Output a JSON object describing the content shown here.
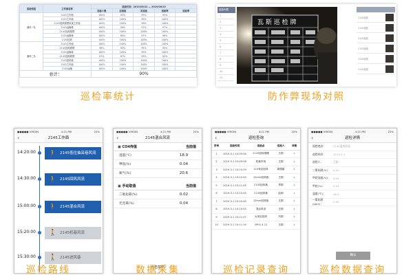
{
  "captions": {
    "stats": "巡检率统计",
    "photo": "防作弊现场对照",
    "route": "巡检路线",
    "collect": "数据采集",
    "records": "巡检记录查询",
    "detail": "巡检数据查询"
  },
  "stats_table": {
    "headers": [
      "巡检班组",
      "工作面名称",
      "巡检时间：2019/08/22 — 2019/08/23"
    ],
    "subheaders": [
      "",
      "",
      "巡检人数",
      "应巡检",
      "实巡检",
      "巡检率",
      "巡检率"
    ],
    "groups": [
      {
        "name": "通风一队",
        "rows": [
          [
            "2145工作面",
            "100%",
            "92%",
            "95%",
            "95%"
          ],
          [
            "2145工作面",
            "100%",
            "100%",
            "99%",
            "100%"
          ],
          [
            "2145回风顺槽采煤工作面",
            "100%",
            "100%",
            "99%",
            "100%"
          ],
          [
            "2145运输巷",
            "100%",
            "90%",
            "97%",
            "97%"
          ],
          [
            "2145回风顺槽",
            "100%",
            "100%",
            "100%",
            "100%"
          ],
          [
            "2145运输巷",
            "100%",
            "80%",
            "87%",
            "96%"
          ],
          [
            "2145回风",
            "100%",
            "100%",
            "100%",
            "100%"
          ]
        ]
      },
      {
        "name": "通风二队",
        "rows": [
          [
            "2145工作面",
            "100%",
            "100%",
            "100%",
            "100%"
          ],
          [
            "2145回风顺槽",
            "98%",
            "92%",
            "95%",
            "95%"
          ],
          [
            "2145运输巷",
            "100%",
            "100%",
            "99%",
            "100%"
          ],
          [
            "2145回风顺槽",
            "87%",
            "87%",
            "93%",
            "92%"
          ],
          [
            "2145回风巷",
            "100%",
            "100%",
            "100%",
            "100%"
          ],
          [
            "2145工作面",
            "100%",
            "100%",
            "100%",
            "100%"
          ],
          [
            "2145运输",
            "100%",
            "100%",
            "100%",
            "100%"
          ]
        ]
      }
    ],
    "total_label": "总计：",
    "total_value": "90%"
  },
  "photo_panel": {
    "list_title": "巡检列表",
    "list_rows": [
      "1",
      "2",
      "3",
      "4",
      "5",
      "6",
      "7",
      "8",
      "9",
      "10",
      "11"
    ],
    "thumb_labels": [
      "2145巡检",
      "2145巡检",
      "2145巡检",
      "2145巡检",
      "2145巡检",
      "2145巡检"
    ]
  },
  "route_phone": {
    "status_left": "●●●●● VIRGIN",
    "status_time": "4:21 PM",
    "status_right": "22%",
    "title": "2145工作面",
    "items": [
      {
        "time": "14:20:00",
        "label": "2145低位抽采巷风流",
        "active": true
      },
      {
        "time": "14:30:00",
        "label": "2145回风风流",
        "active": true
      },
      {
        "time": "15:00:00",
        "label": "2145混合风流",
        "active": true
      },
      {
        "time": "15:20:00",
        "label": "2145机巷风流",
        "active": false
      },
      {
        "time": "15:30:00",
        "label": "2145进风巷",
        "active": false
      }
    ]
  },
  "collect_phone": {
    "status_left": "●●●●● VIRGIN",
    "status_time": "4:21 PM",
    "status_right": "22%",
    "title": "2145混合风流",
    "section1": {
      "title": "CO4传值",
      "col": "当前值"
    },
    "rows1": [
      {
        "label": "温度(℃)",
        "value": "18.9"
      },
      {
        "label": "甲烷(%)",
        "value": "0.04"
      },
      {
        "label": "氧气(%)",
        "value": "20.6"
      }
    ],
    "section2": {
      "title": "手动取值",
      "col": "当前值"
    },
    "rows2": [
      {
        "label": "二氧化碳(%)",
        "value": "0.02"
      },
      {
        "label": "元元率(%)",
        "value": "0.04"
      }
    ],
    "submit": "点击拍照"
  },
  "records_phone": {
    "status_left": "●●●●● VIRGIN",
    "status_time": "4:21 PM",
    "status_right": "22%",
    "title": "巡检查询",
    "headers": [
      "序号",
      "巡检时间",
      "巡检点",
      "巡检人",
      "详情"
    ],
    "rows": [
      [
        "1",
        "2019-3-1 10:09:34",
        "2145回风顺槽",
        "王刚"
      ],
      [
        "2",
        "2019-3-1 10:09:56",
        "机巷车场",
        "王刚"
      ],
      [
        "3",
        "2019-3-1 10:10:29",
        "110采区回风",
        "周德建"
      ],
      [
        "4",
        "2019-3-1 10:10:54",
        "10mm回风巷",
        "王刚"
      ],
      [
        "5",
        "2019-3-1 10:11:05",
        "2145回风巷",
        "李刚"
      ],
      [
        "6",
        "2019-3-1 10:10:45",
        "2145回风巷",
        "赵刚"
      ],
      [
        "7",
        "2019-3-1 10:10:49",
        "10mm回风巷",
        "王刚"
      ],
      [
        "8",
        "2019-3-1 10:10:53",
        "混合风流",
        "王刚"
      ],
      [
        "9",
        "2019-3-1 10:11:07",
        "大采区回风",
        "刘刚"
      ],
      [
        "10",
        "2019-3-1 10:11:19",
        "2PH1.4.12",
        "王刚"
      ]
    ]
  },
  "detail_phone": {
    "status_left": "●●●●● VIRGIN",
    "status_time": "4:21 PM",
    "status_right": "22%",
    "title": "巡检详情",
    "rows": [
      {
        "k": "巡检地点：",
        "v": "2145混合风流"
      },
      {
        "k": "巡检时间：",
        "v": "2019-3-1"
      },
      {
        "k": "巡检人：",
        "v": "王刚"
      },
      {
        "k": "二氧化碳(%)：",
        "v": "0.02"
      },
      {
        "k": "甲烷浓度(%)：",
        "v": "0.04"
      },
      {
        "k": "甲烷(%)：",
        "v": "0.04"
      },
      {
        "k": "温度(℃)：",
        "v": "18.9"
      },
      {
        "k": "一氧化碳(ppm)：",
        "v": "0.00"
      }
    ],
    "button": "确认"
  }
}
